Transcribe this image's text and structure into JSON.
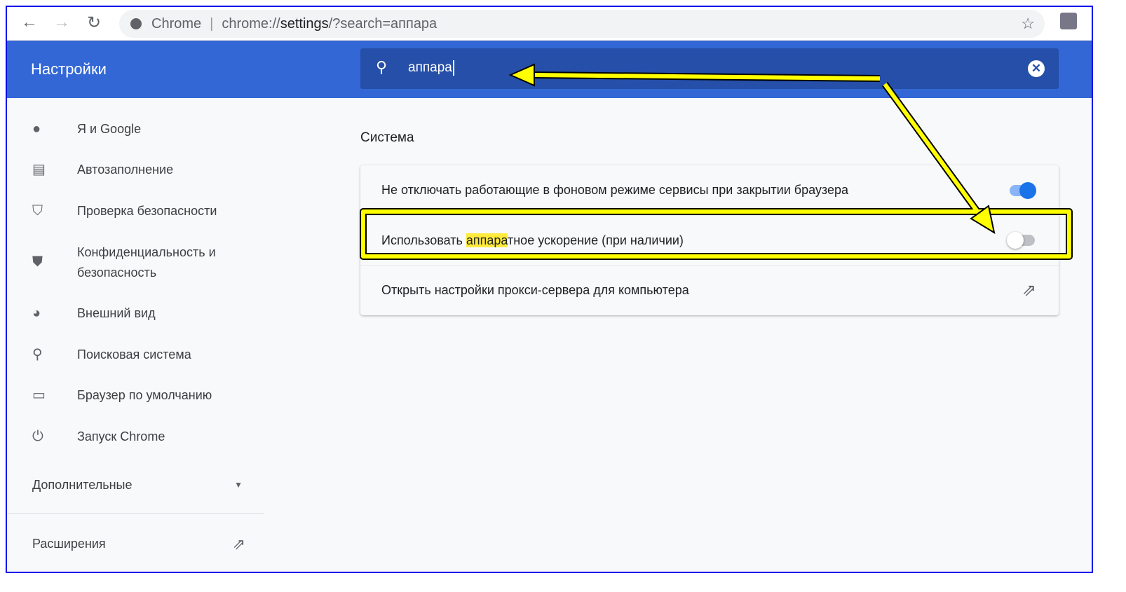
{
  "browser": {
    "tab_label": "Chrome",
    "url_prefix": "chrome://",
    "url_host": "settings",
    "url_rest": "/?search=аппара"
  },
  "header": {
    "title": "Настройки",
    "search_value": "аппара"
  },
  "sidebar": {
    "items": [
      {
        "label": "Я и Google",
        "icon": "person-icon"
      },
      {
        "label": "Автозаполнение",
        "icon": "clipboard-icon"
      },
      {
        "label": "Проверка безопасности",
        "icon": "shield-check-icon"
      },
      {
        "label": "Конфиденциальность и безопасность",
        "icon": "shield-icon"
      },
      {
        "label": "Внешний вид",
        "icon": "palette-icon"
      },
      {
        "label": "Поисковая система",
        "icon": "search-icon"
      },
      {
        "label": "Браузер по умолчанию",
        "icon": "browser-icon"
      },
      {
        "label": "Запуск Chrome",
        "icon": "power-icon"
      }
    ],
    "advanced": "Дополнительные",
    "extensions": "Расширения"
  },
  "main": {
    "section": "Система",
    "rows": [
      {
        "label": "Не отключать работающие в фоновом режиме сервисы при закрытии браузера",
        "toggle": true
      },
      {
        "label_pre": "Использовать ",
        "label_hl": "аппара",
        "label_post": "тное ускорение (при наличии)",
        "toggle": false
      },
      {
        "label": "Открыть настройки прокси-сервера для компьютера"
      }
    ]
  },
  "colors": {
    "accent": "#3367d6",
    "toggle_on": "#1a73e8",
    "highlight": "#ffeb3b",
    "annotation": "#ffff00"
  }
}
